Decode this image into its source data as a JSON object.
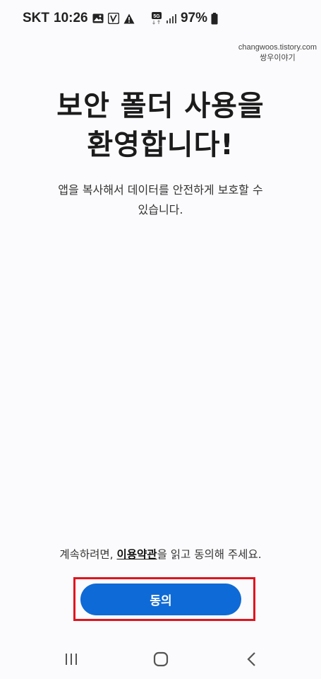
{
  "status_bar": {
    "carrier": "SKT",
    "time": "10:26",
    "network": "5G",
    "battery": "97%",
    "icons": [
      "image-icon",
      "app-notification-icon",
      "warning-icon",
      "network-5g-icon",
      "signal-icon",
      "battery-icon"
    ]
  },
  "watermark": {
    "line1": "changwoos.tistory.com",
    "line2": "쌍우이야기"
  },
  "welcome": {
    "title_line1": "보안 폴더 사용을",
    "title_line2": "환영합니다!",
    "description_line1": "앱을 복사해서 데이터를 안전하게 보호할 수",
    "description_line2": "있습니다."
  },
  "consent": {
    "prefix": "계속하려면,",
    "terms_link": "이용약관",
    "suffix": "을 읽고 동의해 주세요."
  },
  "agree_button": {
    "label": "동의"
  },
  "navigation": {
    "icons": [
      "recent-apps-icon",
      "home-icon",
      "back-icon"
    ]
  },
  "colors": {
    "background": "#fbfbfd",
    "button": "#0e6ad6",
    "highlight": "#e0141e"
  }
}
